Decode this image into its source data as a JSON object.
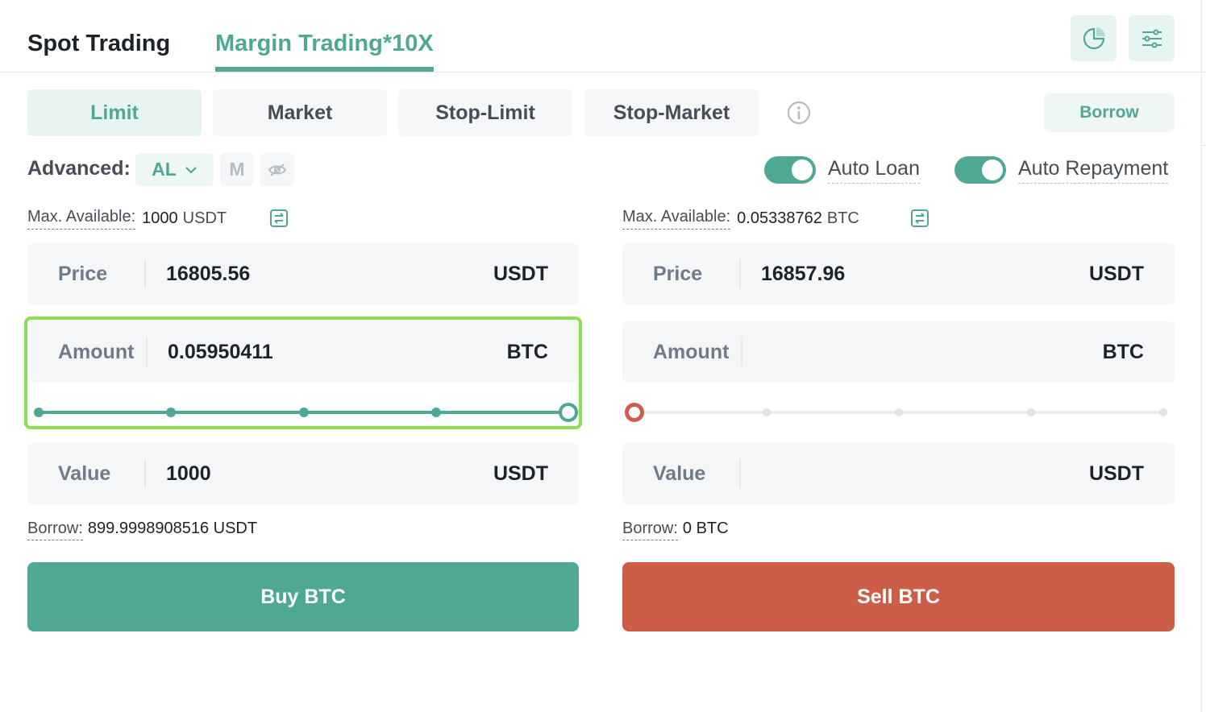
{
  "tabs": {
    "spot": "Spot Trading",
    "margin": "Margin Trading*10X"
  },
  "order_types": [
    "Limit",
    "Market",
    "Stop-Limit",
    "Stop-Market"
  ],
  "active_order_type": "Limit",
  "borrow_button": "Borrow",
  "advanced": {
    "label": "Advanced:",
    "mode": "AL",
    "m_label": "M"
  },
  "toggles": {
    "auto_loan": "Auto Loan",
    "auto_repayment": "Auto Repayment",
    "auto_loan_on": true,
    "auto_repayment_on": true
  },
  "buy": {
    "max_available_label": "Max. Available:",
    "max_available_value": "1000",
    "max_available_unit": "USDT",
    "price_label": "Price",
    "price_value": "16805.56",
    "price_unit": "USDT",
    "amount_label": "Amount",
    "amount_value": "0.05950411",
    "amount_unit": "BTC",
    "slider_percent": 100,
    "value_label": "Value",
    "value_value": "1000",
    "value_unit": "USDT",
    "borrow_label": "Borrow:",
    "borrow_value": "899.9998908516 USDT",
    "button": "Buy BTC"
  },
  "sell": {
    "max_available_label": "Max. Available:",
    "max_available_value": "0.05338762",
    "max_available_unit": "BTC",
    "price_label": "Price",
    "price_value": "16857.96",
    "price_unit": "USDT",
    "amount_label": "Amount",
    "amount_value": "",
    "amount_unit": "BTC",
    "slider_percent": 0,
    "value_label": "Value",
    "value_value": "",
    "value_unit": "USDT",
    "borrow_label": "Borrow:",
    "borrow_value": "0 BTC",
    "button": "Sell BTC"
  },
  "colors": {
    "accent": "#4fa895",
    "sell": "#cc5e48",
    "highlight": "#8be04e"
  }
}
